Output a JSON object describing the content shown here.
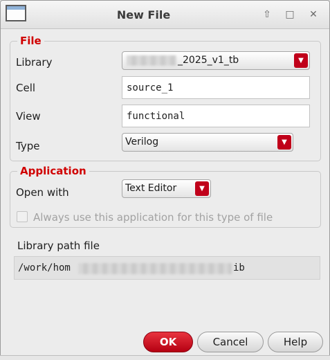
{
  "window": {
    "title": "New File",
    "controls": [
      "up-arrow-icon",
      "maximize-icon",
      "close-icon"
    ]
  },
  "file_group": {
    "title": "File",
    "library_label": "Library",
    "library_value": "_2025_v1_tb",
    "cell_label": "Cell",
    "cell_value": "source_1",
    "view_label": "View",
    "view_value": "functional",
    "type_label": "Type",
    "type_value": "Verilog"
  },
  "application_group": {
    "title": "Application",
    "open_with_label": "Open with",
    "open_with_value": "Text Editor",
    "always_use_label": "Always use this application for this type of file",
    "always_use_checked": false
  },
  "library_path": {
    "label": "Library path file",
    "value_start": "/work/hom",
    "value_end": "ib"
  },
  "buttons": {
    "ok": "OK",
    "cancel": "Cancel",
    "help": "Help"
  },
  "colors": {
    "accent": "#c0001a",
    "section_title": "#d00000"
  }
}
